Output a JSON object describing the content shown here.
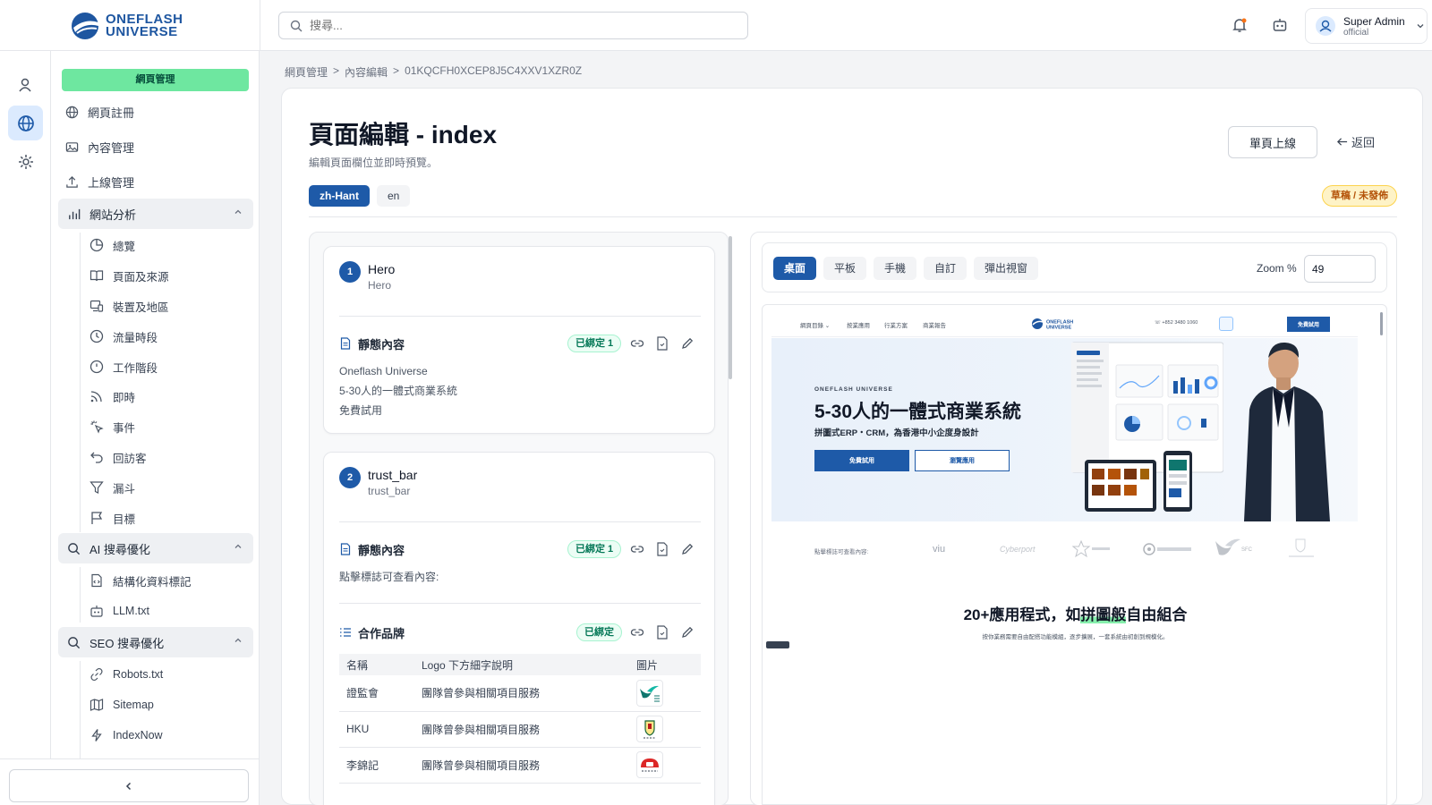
{
  "brand": {
    "line1": "ONEFLASH",
    "line2": "UNIVERSE"
  },
  "search": {
    "placeholder": "搜尋..."
  },
  "user": {
    "name": "Super Admin",
    "role": "official"
  },
  "sidebar": {
    "section_pill": "網頁管理",
    "items": [
      {
        "label": "網頁註冊",
        "icon": "globe-icon"
      },
      {
        "label": "內容管理",
        "icon": "image-icon"
      },
      {
        "label": "上線管理",
        "icon": "upload-icon"
      }
    ],
    "analytics": {
      "label": "網站分析",
      "items": [
        "總覽",
        "頁面及來源",
        "裝置及地區",
        "流量時段",
        "工作階段",
        "即時",
        "事件",
        "回訪客",
        "漏斗",
        "目標"
      ]
    },
    "ai": {
      "label": "AI 搜尋優化",
      "items": [
        "結構化資料標記",
        "LLM.txt"
      ]
    },
    "seo": {
      "label": "SEO 搜尋優化",
      "items": [
        "Robots.txt",
        "Sitemap",
        "IndexNow"
      ]
    }
  },
  "breadcrumb": [
    "網頁管理",
    "內容編輯",
    "01KQCFH0XCEP8J5C4XXV1XZR0Z"
  ],
  "page": {
    "title": "頁面編輯 - index",
    "subtitle": "編輯頁面欄位並即時預覽。",
    "langs": [
      "zh-Hant",
      "en"
    ],
    "publish_label": "單頁上線",
    "back_label": "返回",
    "status": "草稿 / 未發佈"
  },
  "blocks": [
    {
      "num": "1",
      "name": "Hero",
      "sub": "Hero",
      "section_title": "靜態內容",
      "badge": "已綁定 1",
      "lines": [
        "Oneflash Universe",
        "5-30人的一體式商業系統",
        "免費試用"
      ]
    },
    {
      "num": "2",
      "name": "trust_bar",
      "sub": "trust_bar",
      "section_title": "靜態內容",
      "badge": "已綁定 1",
      "lines": [
        "點擊標誌可查看內容:"
      ],
      "brands": {
        "title": "合作品牌",
        "badge": "已綁定",
        "headers": [
          "名稱",
          "Logo 下方細字說明",
          "圖片"
        ],
        "rows": [
          {
            "name": "證監會",
            "desc": "團隊曾參與相關項目服務"
          },
          {
            "name": "HKU",
            "desc": "團隊曾參與相關項目服務"
          },
          {
            "name": "李錦記",
            "desc": "團隊曾參與相關項目服務"
          }
        ]
      }
    }
  ],
  "preview": {
    "devices": [
      "桌面",
      "平板",
      "手機",
      "自訂",
      "彈出視窗"
    ],
    "zoom_label": "Zoom %",
    "zoom_value": "49",
    "site": {
      "nav": [
        "網頁目錄 ⌄",
        "按業應用",
        "行業方案",
        "商業報告"
      ],
      "phone": "☏ +852 3480 1060",
      "cta": "免費試用",
      "eyebrow": "ONEFLASH UNIVERSE",
      "hero_title": "5-30人的一體式商業系統",
      "hero_desc": "拼圖式ERP・CRM，為香港中小企度身設計",
      "btn_primary": "免費試用",
      "btn_secondary": "瀏覽應用",
      "trust_label": "點擊標誌可查看內容:",
      "trust_logos": [
        "viu",
        "Cyberport",
        "SFC"
      ],
      "section_title_a": "20+應用程式，如",
      "section_title_b": "拼圖般",
      "section_title_c": "自由組合",
      "section_sub": "按你業務需要自由配搭功能模組，逐步擴展，一套系統由初創到規模化。"
    }
  },
  "colors": {
    "primary": "#1e5aa8",
    "accent_green": "#6ee7a0",
    "draft": "#b45309"
  }
}
